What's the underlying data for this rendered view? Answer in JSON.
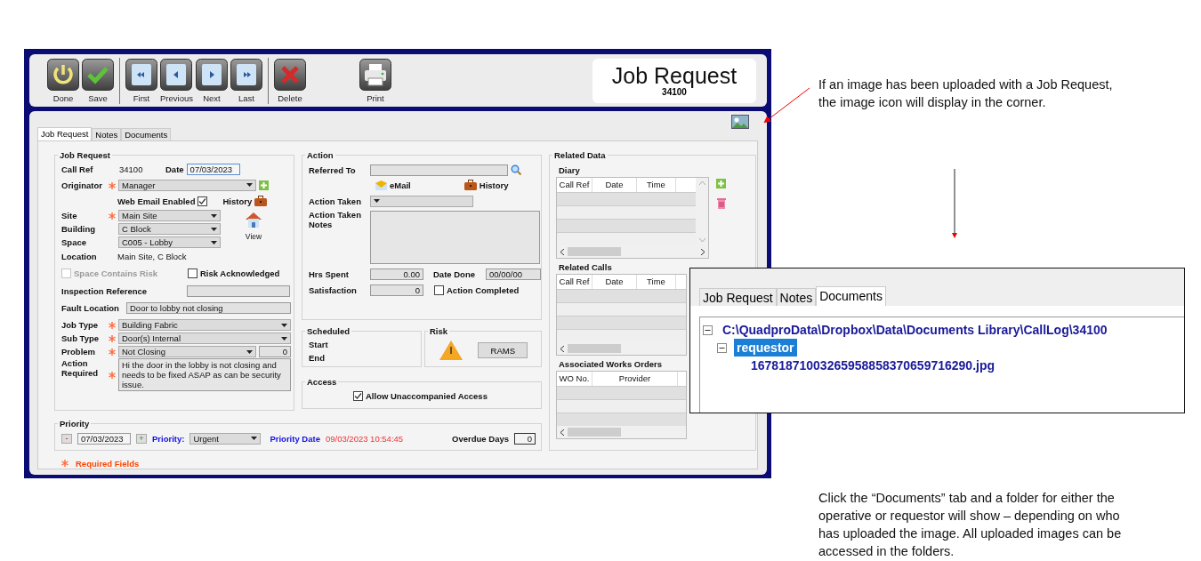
{
  "toolbar": {
    "groups": [
      {
        "divider": true,
        "buttons": [
          {
            "label": "Done",
            "kind": "power"
          },
          {
            "label": "Save",
            "kind": "check"
          }
        ]
      },
      {
        "divider": true,
        "buttons": [
          {
            "label": "First",
            "kind": "first"
          },
          {
            "label": "Previous",
            "kind": "previous"
          },
          {
            "label": "Next",
            "kind": "next"
          },
          {
            "label": "Last",
            "kind": "last"
          }
        ]
      },
      {
        "divider": false,
        "buttons": [
          {
            "label": "Delete",
            "kind": "delete"
          }
        ]
      },
      {
        "divider": false,
        "buttons": [
          {
            "label": "Print",
            "kind": "print"
          }
        ]
      }
    ],
    "title": "Job Request",
    "number": "34100"
  },
  "tabs": [
    {
      "label": "Job Request",
      "selected": true
    },
    {
      "label": "Notes",
      "selected": false
    },
    {
      "label": "Documents",
      "selected": false
    }
  ],
  "job_request": {
    "title": "Job Request",
    "call_ref": {
      "label": "Call Ref",
      "value": "34100"
    },
    "date": {
      "label": "Date",
      "value": "07/03/2023"
    },
    "originator": {
      "label": "Originator",
      "required": true,
      "value": "Manager"
    },
    "web_email": {
      "label": "Web Email Enabled",
      "checked": true
    },
    "history": {
      "label": "History"
    },
    "site": {
      "label": "Site",
      "required": true,
      "value": "Main Site"
    },
    "building": {
      "label": "Building",
      "required": false,
      "value": "C Block"
    },
    "space": {
      "label": "Space",
      "required": false,
      "value": "C005 - Lobby"
    },
    "view": {
      "label": "View"
    },
    "location": {
      "label": "Location",
      "value": "Main Site, C Block"
    },
    "space_risk": {
      "label": "Space Contains Risk",
      "checked": false,
      "disabled": true
    },
    "risk_ack": {
      "label": "Risk Acknowledged",
      "checked": false,
      "disabled": false
    },
    "inspection": {
      "label": "Inspection Reference"
    },
    "fault_location": {
      "label": "Fault Location",
      "value": "Door to lobby not closing"
    },
    "job_type": {
      "label": "Job Type",
      "required": true,
      "value": "Building Fabric"
    },
    "sub_type": {
      "label": "Sub Type",
      "required": true,
      "value": "Door(s) Internal"
    },
    "problem": {
      "label": "Problem",
      "required": true,
      "value": "Not Closing",
      "count": "0"
    },
    "action_required": {
      "label": "Action Required",
      "required": true,
      "value": "Hi the door in the lobby is not closing and needs to be fixed ASAP as can be security issue."
    }
  },
  "action": {
    "title": "Action",
    "referred_to": {
      "label": "Referred To"
    },
    "email": {
      "label": "eMail"
    },
    "history": {
      "label": "History"
    },
    "action_taken": {
      "label": "Action Taken"
    },
    "notes": {
      "label": "Action Taken Notes"
    },
    "hrs_spent": {
      "label": "Hrs Spent",
      "value": "0.00"
    },
    "date_done": {
      "label": "Date Done",
      "value": "00/00/00"
    },
    "satisfaction": {
      "label": "Satisfaction",
      "value": "0"
    },
    "completed": {
      "label": "Action Completed",
      "checked": false
    }
  },
  "scheduled": {
    "title": "Scheduled",
    "start": "Start",
    "end": "End"
  },
  "risk": {
    "title": "Risk",
    "button": "RAMS"
  },
  "access": {
    "title": "Access",
    "allow": {
      "label": "Allow Unaccompanied Access",
      "checked": true
    }
  },
  "priority": {
    "title": "Priority",
    "minus": "-",
    "date": "07/03/2023",
    "plus": "+",
    "label": "Priority:",
    "value": "Urgent",
    "date_label": "Priority Date",
    "date_value": "09/03/2023 10:54:45",
    "overdue_label": "Overdue Days",
    "overdue_value": "0"
  },
  "required_note": "Required Fields",
  "related": {
    "title": "Related Data",
    "tables": [
      {
        "title": "Diary",
        "actions": true,
        "columns": [
          "Call Ref",
          "Date",
          "Time"
        ]
      },
      {
        "title": "Related Calls",
        "columns": [
          "Call Ref",
          "Date",
          "Time"
        ]
      },
      {
        "title": "Associated Works Orders",
        "columns": [
          "WO No.",
          "Provider"
        ]
      }
    ]
  },
  "inset": {
    "tabs": [
      {
        "label": "Job Request",
        "selected": false
      },
      {
        "label": "Notes",
        "selected": false
      },
      {
        "label": "Documents",
        "selected": true
      }
    ],
    "tree": [
      {
        "label": "C:\\QuadproData\\Dropbox\\Data\\Documents Library\\CallLog\\34100",
        "expanded": true,
        "selected": false,
        "children": [
          {
            "label": "requestor",
            "expanded": true,
            "selected": true,
            "children": [
              {
                "label": "16781871003265958858370659716290.jpg",
                "selected": false
              }
            ]
          }
        ]
      }
    ]
  },
  "annotations": [
    "If an image has been uploaded with a Job Request, the image icon will display in the corner.",
    "Click the “Documents” tab and a folder for either the operative or requestor will show – depending on who has uploaded the image. All uploaded images can be accessed in the folders."
  ]
}
